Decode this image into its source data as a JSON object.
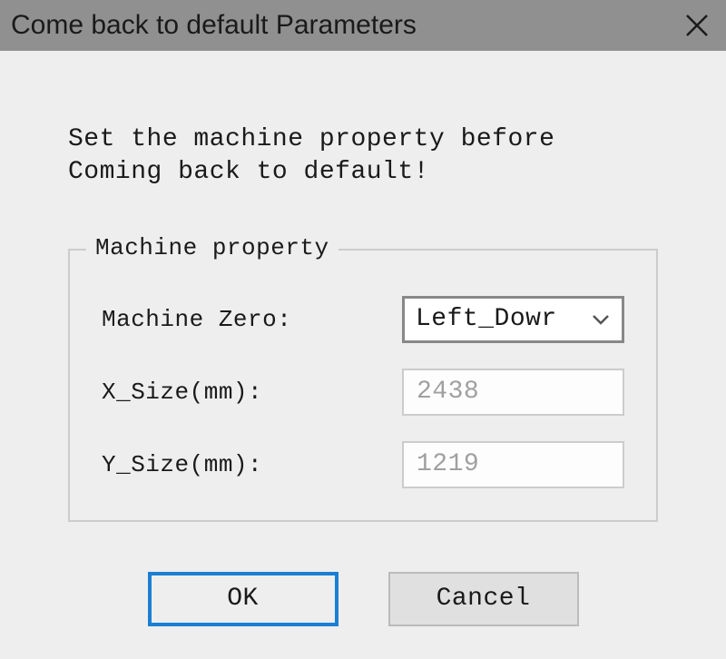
{
  "title": "Come back to default Parameters",
  "instruction": "Set the machine property before Coming back to default!",
  "group": {
    "legend": "Machine property",
    "machine_zero_label": "Machine Zero:",
    "machine_zero_value": "Left_Dowr",
    "x_size_label": "X_Size(mm):",
    "x_size_value": "2438",
    "y_size_label": "Y_Size(mm):",
    "y_size_value": "1219"
  },
  "buttons": {
    "ok": "OK",
    "cancel": "Cancel"
  }
}
